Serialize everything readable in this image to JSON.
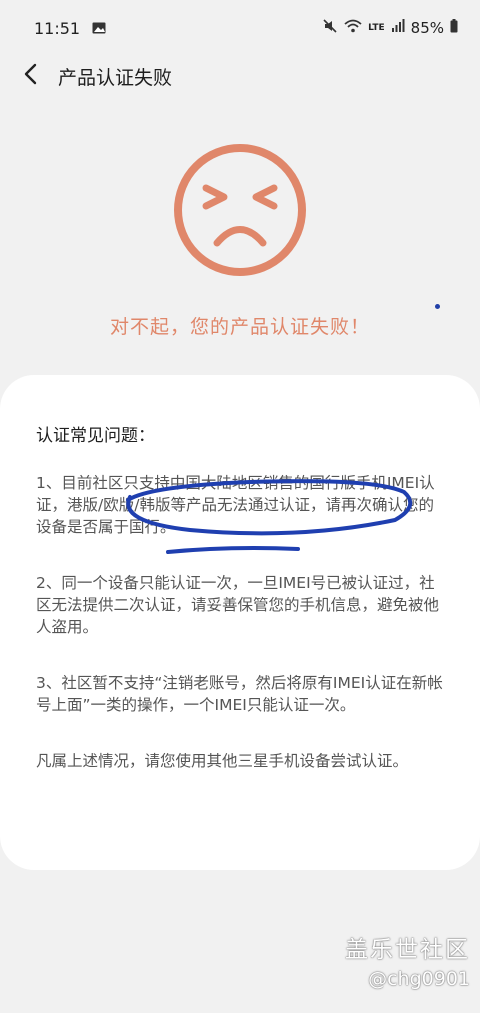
{
  "status_bar": {
    "time": "11:51",
    "network": "LTE",
    "battery": "85%",
    "icons": [
      "gallery-icon",
      "mute-icon",
      "wifi-icon",
      "signal-icon",
      "battery-icon"
    ]
  },
  "header": {
    "back_icon": "chevron-left-icon",
    "title": "产品认证失败"
  },
  "result": {
    "face_icon": "sad-face-icon",
    "message": "对不起，您的产品认证失败！",
    "accent_color": "#e0876a"
  },
  "faq": {
    "title": "认证常见问题：",
    "items": [
      "1、目前社区只支持中国大陆地区销售的国行版手机IMEI认证，港版/欧版/韩版等产品无法通过认证，请再次确认您的设备是否属于国行。",
      "2、同一个设备只能认证一次，一旦IMEI号已被认证过，社区无法提供二次认证，请妥善保管您的手机信息，避免被他人盗用。",
      "3、社区暂不支持“注销老账号，然后将原有IMEI认证在新帐号上面”一类的操作，一个IMEI只能认证一次。",
      "凡属上述情况，请您使用其他三星手机设备尝试认证。"
    ]
  },
  "annotation_color": "#1f3fb0",
  "watermark": {
    "brand": "盖乐世社区",
    "user": "@chg0901"
  }
}
